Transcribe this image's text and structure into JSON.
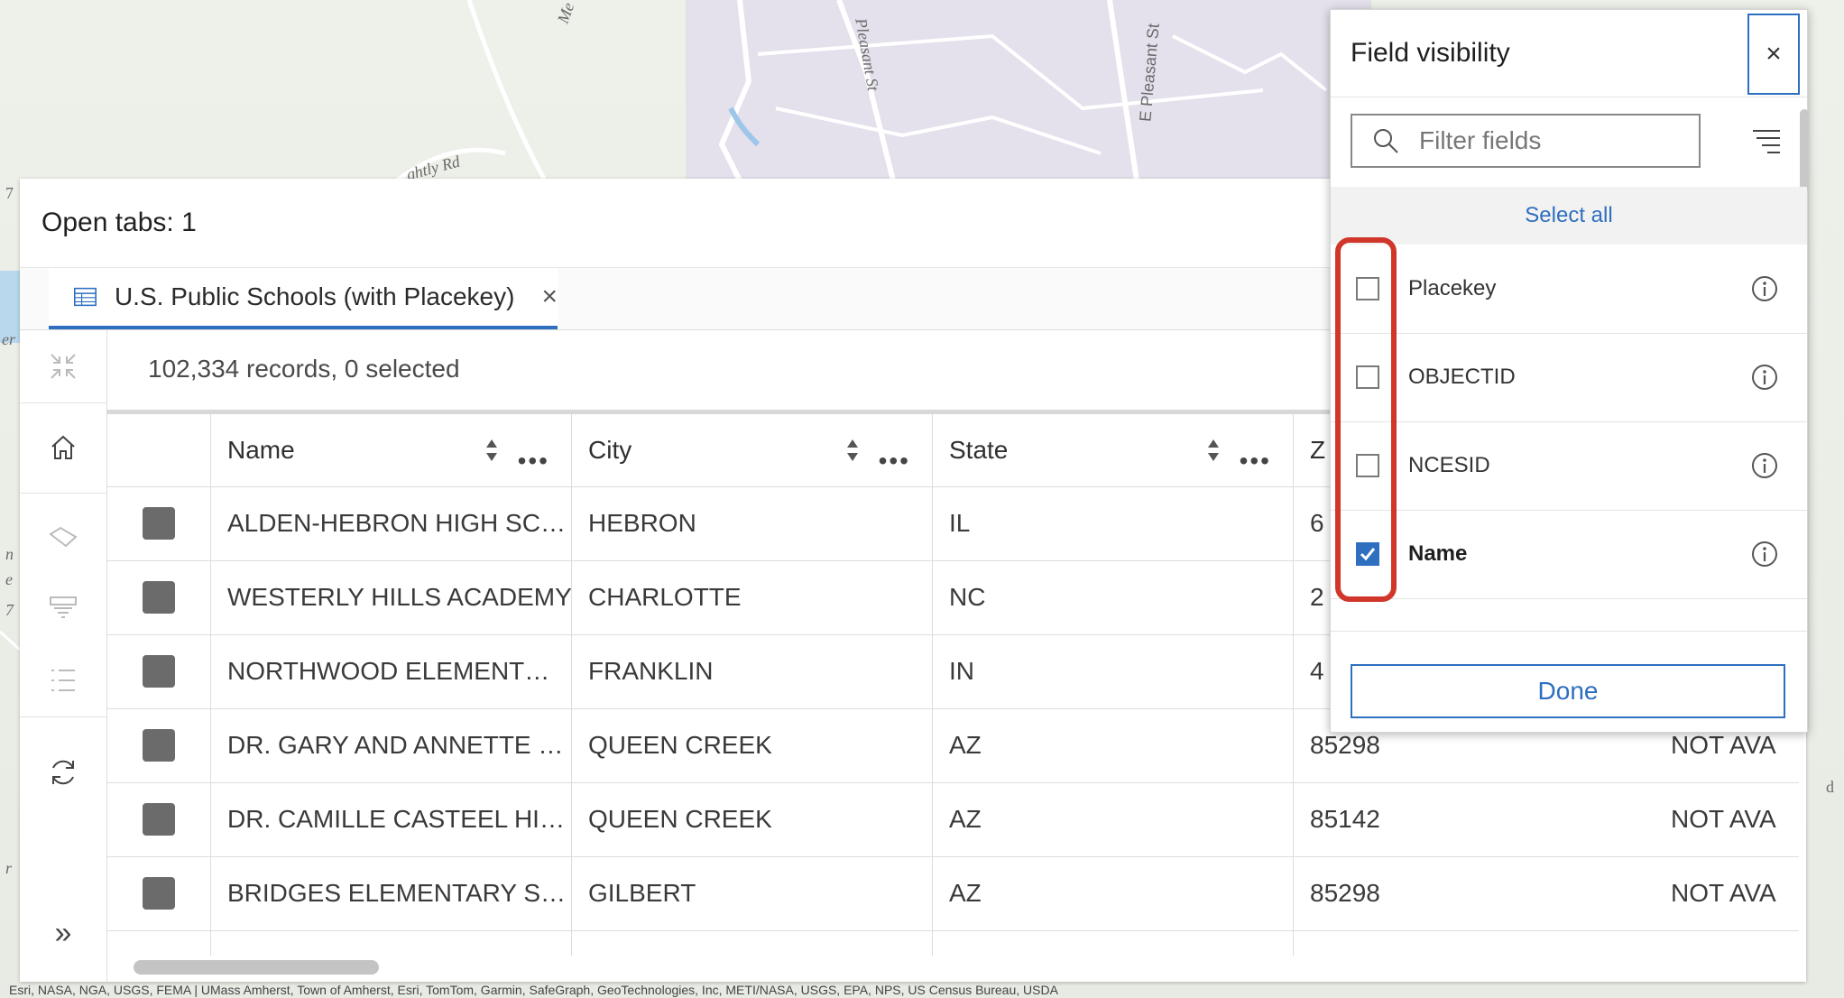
{
  "map": {
    "labels": [
      "Me",
      "Pleasant St",
      "E Pleasant St",
      "ghtly Rd",
      "7",
      "er",
      "n",
      "e",
      "7",
      "r",
      "d"
    ],
    "attribution": "Esri, NASA, NGA, USGS, FEMA | UMass Amherst, Town of Amherst, Esri, TomTom, Garmin, SafeGraph, GeoTechnologies, Inc, METI/NASA, USGS, EPA, NPS, US Census Bureau, USDA"
  },
  "table_panel": {
    "title": "Open tabs: 1",
    "tab": {
      "label": "U.S. Public Schools (with Placekey)",
      "close": "×",
      "icon": "table-icon"
    },
    "records_info": "102,334 records, 0 selected",
    "toolbar_icons": [
      "collapse-icon",
      "home-icon",
      "tag-icon",
      "filter-icon",
      "list-icon",
      "refresh-icon",
      "expand-icon"
    ],
    "expand_glyph": "»",
    "columns": [
      "Name",
      "City",
      "State",
      "Z"
    ],
    "rows": [
      {
        "name": "ALDEN-HEBRON HIGH SC…",
        "city": "HEBRON",
        "state": "IL",
        "zip": "6",
        "extra": ""
      },
      {
        "name": "WESTERLY HILLS ACADEMY",
        "city": "CHARLOTTE",
        "state": "NC",
        "zip": "2",
        "extra": ""
      },
      {
        "name": "NORTHWOOD ELEMENT…",
        "city": "FRANKLIN",
        "state": "IN",
        "zip": "4",
        "extra": ""
      },
      {
        "name": "DR. GARY AND ANNETTE …",
        "city": "QUEEN CREEK",
        "state": "AZ",
        "zip": "85298",
        "extra": "NOT AVA"
      },
      {
        "name": "DR. CAMILLE CASTEEL HI…",
        "city": "QUEEN CREEK",
        "state": "AZ",
        "zip": "85142",
        "extra": "NOT AVA"
      },
      {
        "name": "BRIDGES ELEMENTARY S…",
        "city": "GILBERT",
        "state": "AZ",
        "zip": "85298",
        "extra": "NOT AVA"
      }
    ],
    "more_glyph": "•••"
  },
  "field_visibility": {
    "title": "Field visibility",
    "close": "×",
    "filter_placeholder": "Filter fields",
    "select_all": "Select all",
    "fields": [
      {
        "name": "Placekey",
        "checked": false
      },
      {
        "name": "OBJECTID",
        "checked": false
      },
      {
        "name": "NCESID",
        "checked": false
      },
      {
        "name": "Name",
        "checked": true
      }
    ],
    "done": "Done",
    "accent_color": "#2e6fbf",
    "highlight_color": "#d0362a"
  }
}
